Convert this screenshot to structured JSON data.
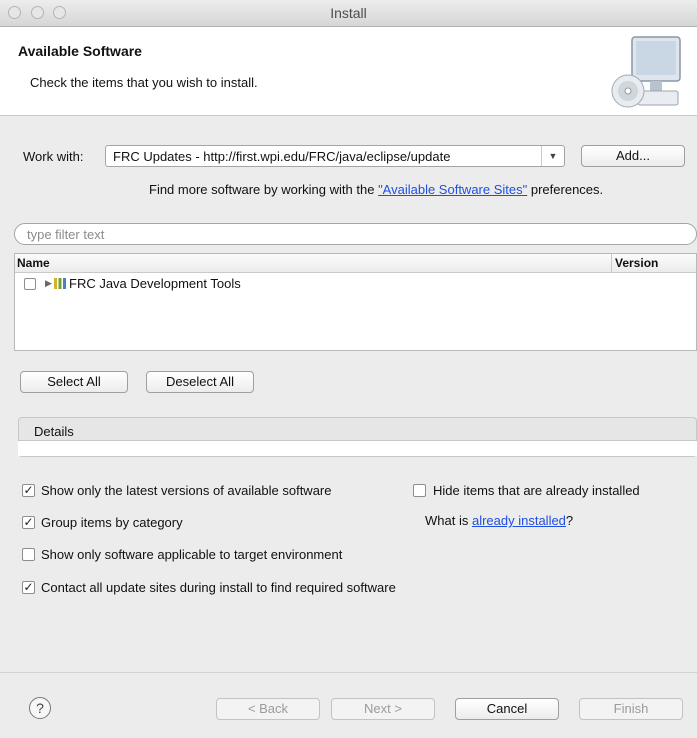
{
  "window": {
    "title": "Install"
  },
  "banner": {
    "title": "Available Software",
    "subtitle": "Check the items that you wish to install."
  },
  "work_with": {
    "label": "Work with:",
    "value": "FRC Updates - http://first.wpi.edu/FRC/java/eclipse/update",
    "add_label": "Add..."
  },
  "find_more": {
    "prefix": "Find more software by working with the",
    "link": "\"Available Software Sites\"",
    "suffix": "preferences."
  },
  "filter": {
    "placeholder": "type filter text"
  },
  "tree": {
    "columns": [
      "Name",
      "Version"
    ],
    "items": [
      {
        "label": "FRC Java Development Tools",
        "checked": false
      }
    ]
  },
  "selection": {
    "select_all": "Select All",
    "deselect_all": "Deselect All"
  },
  "details": {
    "label": "Details"
  },
  "options": {
    "latest_only": {
      "label": "Show only the latest versions of available software",
      "checked": true
    },
    "hide_installed": {
      "label": "Hide items that are already installed",
      "checked": false
    },
    "group_category": {
      "label": "Group items by category",
      "checked": true
    },
    "what_is_prefix": "What is",
    "what_is_link": "already installed",
    "what_is_suffix": "?",
    "target_env": {
      "label": "Show only software applicable to target environment",
      "checked": false
    },
    "contact_sites": {
      "label": "Contact all update sites during install to find required software",
      "checked": true
    }
  },
  "footer": {
    "help_glyph": "?",
    "back": "< Back",
    "next": "Next >",
    "cancel": "Cancel",
    "finish": "Finish"
  },
  "glyphs": {
    "check": "✓",
    "dropdown_arrow": "▼",
    "expand": "▶"
  }
}
